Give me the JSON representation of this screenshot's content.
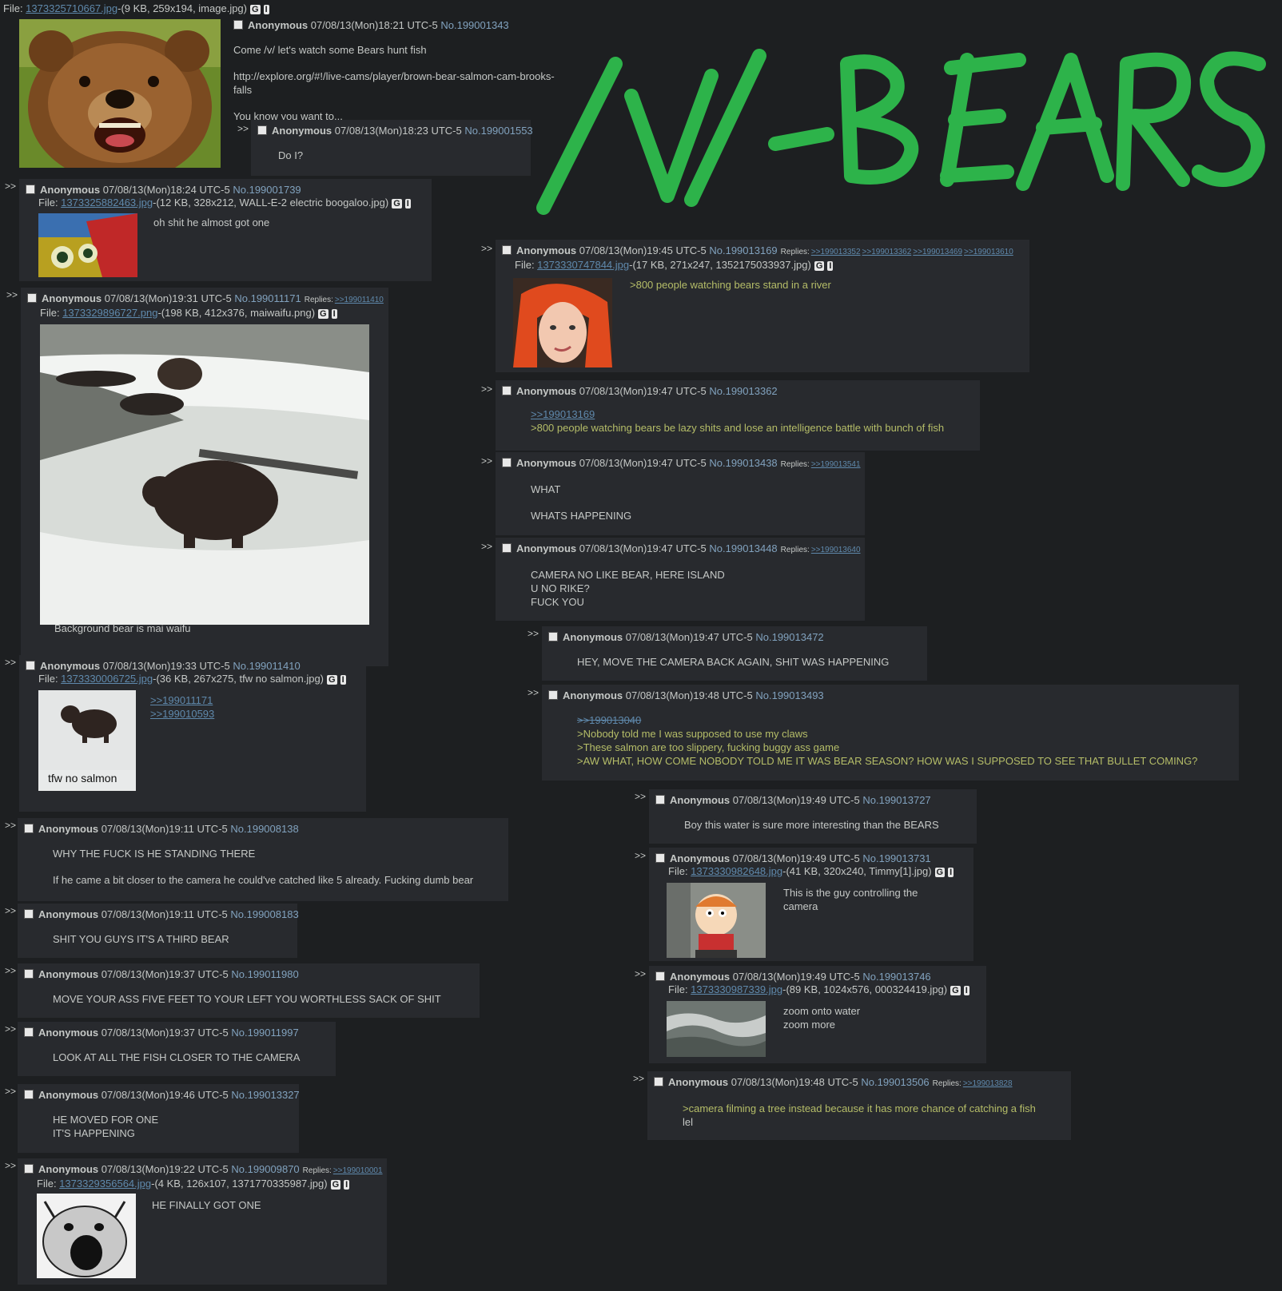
{
  "op": {
    "file_prefix": "File: ",
    "file_link": "1373325710667.jpg",
    "file_info": "-(9 KB, 259x194, image.jpg)",
    "name": "Anonymous",
    "date": "07/08/13(Mon)18:21 UTC-5",
    "no": "No.199001343",
    "lines": [
      "Come /v/ let's watch some Bears hunt fish",
      "http://explore.org/#!/live-cams/player/brown-bear-salmon-cam-brooks-falls",
      "You know you want to..."
    ]
  },
  "title_art": "/V/-BEARS",
  "arrow": ">>",
  "file_label": "File: ",
  "replies_label": "Replies:",
  "g": "G",
  "i": "I",
  "posts": {
    "p1553": {
      "name": "Anonymous",
      "date": "07/08/13(Mon)18:23 UTC-5",
      "no": "No.199001553",
      "text": "Do I?"
    },
    "p1739": {
      "name": "Anonymous",
      "date": "07/08/13(Mon)18:24 UTC-5",
      "no": "No.199001739",
      "file_link": "1373325882463.jpg",
      "file_info": "-(12 KB, 328x212, WALL-E-2 electric boogaloo.jpg)",
      "text": "oh shit he almost got one"
    },
    "p11171": {
      "name": "Anonymous",
      "date": "07/08/13(Mon)19:31 UTC-5",
      "no": "No.199011171",
      "reply1": ">>199011410",
      "file_link": "1373329896727.png",
      "file_info": "-(198 KB, 412x376, maiwaifu.png)",
      "text": "Background bear is mai waifu"
    },
    "p11410": {
      "name": "Anonymous",
      "date": "07/08/13(Mon)19:33 UTC-5",
      "no": "No.199011410",
      "file_link": "1373330006725.jpg",
      "file_info": "-(36 KB, 267x275, tfw no salmon.jpg)",
      "q1": ">>199011171",
      "q2": ">>199010593",
      "thumb_caption": "tfw no salmon"
    },
    "p8138": {
      "name": "Anonymous",
      "date": "07/08/13(Mon)19:11 UTC-5",
      "no": "No.199008138",
      "l1": "WHY THE FUCK IS HE STANDING THERE",
      "l2": "If he came a bit closer to the camera he could've catched like 5 already. Fucking dumb bear"
    },
    "p8183": {
      "name": "Anonymous",
      "date": "07/08/13(Mon)19:11 UTC-5",
      "no": "No.199008183",
      "text": "SHIT YOU GUYS IT'S A THIRD BEAR"
    },
    "p11980": {
      "name": "Anonymous",
      "date": "07/08/13(Mon)19:37 UTC-5",
      "no": "No.199011980",
      "text": "MOVE YOUR ASS FIVE FEET TO YOUR LEFT YOU WORTHLESS SACK OF SHIT"
    },
    "p11997": {
      "name": "Anonymous",
      "date": "07/08/13(Mon)19:37 UTC-5",
      "no": "No.199011997",
      "text": "LOOK AT ALL THE FISH CLOSER TO THE CAMERA"
    },
    "p13327": {
      "name": "Anonymous",
      "date": "07/08/13(Mon)19:46 UTC-5",
      "no": "No.199013327",
      "l1": "HE MOVED FOR ONE",
      "l2": "IT'S HAPPENING"
    },
    "p9870": {
      "name": "Anonymous",
      "date": "07/08/13(Mon)19:22 UTC-5",
      "no": "No.199009870",
      "reply1": ">>199010001",
      "file_link": "1373329356564.jpg",
      "file_info": "-(4 KB, 126x107, 1371770335987.jpg)",
      "text": "HE FINALLY GOT ONE"
    },
    "p13169": {
      "name": "Anonymous",
      "date": "07/08/13(Mon)19:45 UTC-5",
      "no": "No.199013169",
      "reply1": ">>199013352",
      "reply2": ">>199013362",
      "reply3": ">>199013469",
      "reply4": ">>199013610",
      "file_link": "1373330747844.jpg",
      "file_info": "-(17 KB, 271x247, 1352175033937.jpg)",
      "text": ">800 people watching bears stand in a river"
    },
    "p13362": {
      "name": "Anonymous",
      "date": "07/08/13(Mon)19:47 UTC-5",
      "no": "No.199013362",
      "q1": ">>199013169",
      "text": ">800 people watching bears be lazy shits and lose an intelligence battle with bunch of fish"
    },
    "p13438": {
      "name": "Anonymous",
      "date": "07/08/13(Mon)19:47 UTC-5",
      "no": "No.199013438",
      "reply1": ">>199013541",
      "l1": "WHAT",
      "l2": "WHATS HAPPENING"
    },
    "p13448": {
      "name": "Anonymous",
      "date": "07/08/13(Mon)19:47 UTC-5",
      "no": "No.199013448",
      "reply1": ">>199013640",
      "l1": "CAMERA NO LIKE BEAR, HERE ISLAND",
      "l2": "U NO RIKE?",
      "l3": "FUCK YOU"
    },
    "p13472": {
      "name": "Anonymous",
      "date": "07/08/13(Mon)19:47 UTC-5",
      "no": "No.199013472",
      "text": "HEY, MOVE THE CAMERA BACK AGAIN, SHIT WAS HAPPENING"
    },
    "p13493": {
      "name": "Anonymous",
      "date": "07/08/13(Mon)19:48 UTC-5",
      "no": "No.199013493",
      "dead": ">>199013040",
      "l1": ">Nobody told me I was supposed to use my claws",
      "l2": ">These salmon are too slippery, fucking buggy ass game",
      "l3": ">AW WHAT, HOW COME NOBODY TOLD ME IT WAS BEAR SEASON? HOW WAS I SUPPOSED TO SEE THAT BULLET COMING?"
    },
    "p13727": {
      "name": "Anonymous",
      "date": "07/08/13(Mon)19:49 UTC-5",
      "no": "No.199013727",
      "text": "Boy this water is sure more interesting than the BEARS"
    },
    "p13731": {
      "name": "Anonymous",
      "date": "07/08/13(Mon)19:49 UTC-5",
      "no": "No.199013731",
      "file_link": "1373330982648.jpg",
      "file_info": "-(41 KB, 320x240, Timmy[1].jpg)",
      "l1": "This is the guy controlling the",
      "l2": "camera"
    },
    "p13746": {
      "name": "Anonymous",
      "date": "07/08/13(Mon)19:49 UTC-5",
      "no": "No.199013746",
      "file_link": "1373330987339.jpg",
      "file_info": "-(89 KB, 1024x576, 000324419.jpg)",
      "l1": "zoom onto water",
      "l2": "zoom more"
    },
    "p13506": {
      "name": "Anonymous",
      "date": "07/08/13(Mon)19:48 UTC-5",
      "no": "No.199013506",
      "reply1": ">>199013828",
      "l1": ">camera filming a tree instead because it has more chance of catching a fish",
      "l2": "lel"
    }
  },
  "colors": {
    "bg": "#1d1f21",
    "post": "#282a2e",
    "link": "#81a2be",
    "quote": "#b5bd68",
    "title_art": "#2db34a"
  }
}
